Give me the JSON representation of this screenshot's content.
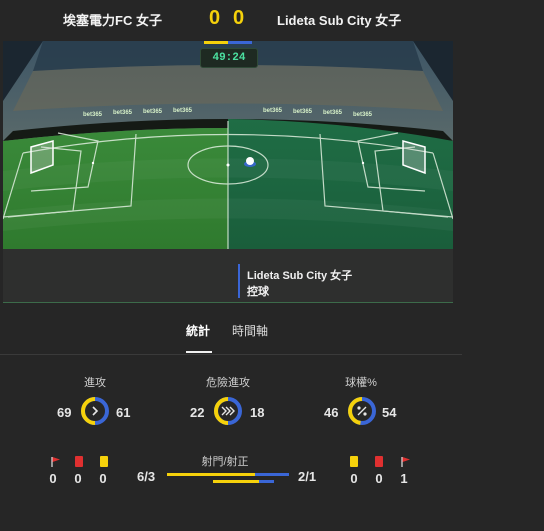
{
  "match": {
    "home_team": "埃塞電力FC 女子",
    "away_team": "Lideta Sub City 女子",
    "home_score": "0",
    "away_score": "0",
    "clock": "49:24"
  },
  "event": {
    "team": "Lideta Sub City 女子",
    "action": "控球"
  },
  "tabs": [
    {
      "label": "統計",
      "active": true
    },
    {
      "label": "時間軸",
      "active": false
    }
  ],
  "stats": {
    "attacks": {
      "label": "進攻",
      "home": "69",
      "away": "61"
    },
    "dangerous_attacks": {
      "label": "危險進攻",
      "home": "22",
      "away": "18"
    },
    "possession": {
      "label": "球權%",
      "home": "46",
      "away": "54"
    }
  },
  "shots": {
    "label": "射門/射正",
    "home": "6/3",
    "away": "2/1"
  },
  "home_cards": {
    "corners": "0",
    "red": "0",
    "yellow": "0"
  },
  "away_cards": {
    "yellow": "0",
    "red": "0",
    "corners": "1"
  },
  "colors": {
    "home": "#f5d10b",
    "away": "#3a66d6",
    "background": "#262626",
    "red_card": "#e03030"
  }
}
